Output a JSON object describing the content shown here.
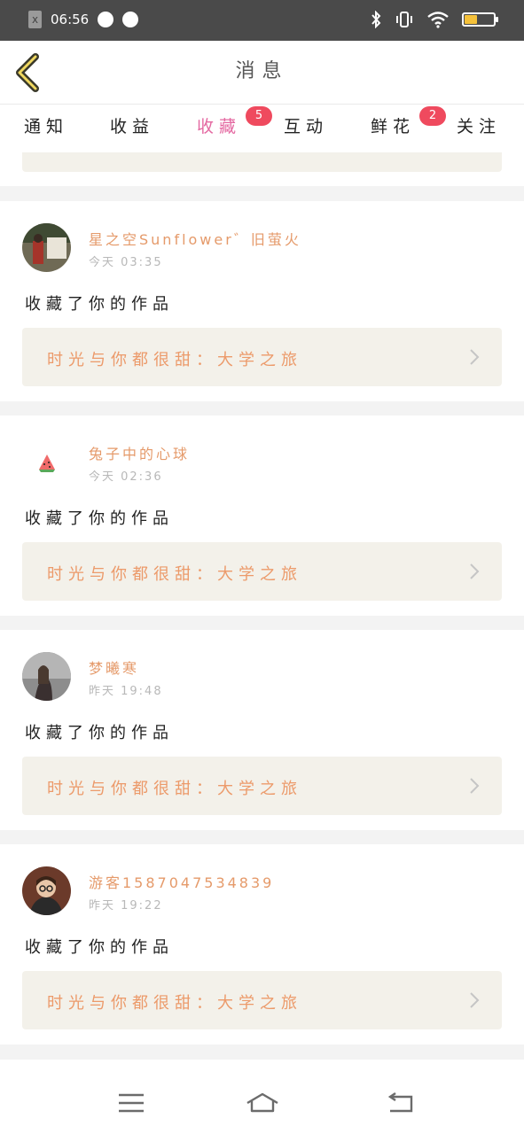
{
  "status_bar": {
    "time": "06:56",
    "notif_icon_label": "x"
  },
  "header": {
    "title": "消息",
    "back_icon": "chevron-left-icon"
  },
  "tabs": [
    {
      "label": "通知",
      "active": false
    },
    {
      "label": "收益",
      "active": false
    },
    {
      "label": "收藏",
      "active": true,
      "badge": "5"
    },
    {
      "label": "互动",
      "active": false
    },
    {
      "label": "鲜花",
      "active": false,
      "badge": "2"
    },
    {
      "label": "关注",
      "active": false
    }
  ],
  "notifications": [
    {
      "user": "星之空Sunflower゛旧萤火",
      "time": "今天 03:35",
      "action": "收藏了你的作品",
      "work": "时光与你都很甜：大学之旅",
      "avatar": "avatar-photo-1"
    },
    {
      "user": "兔子中的心球",
      "time": "今天 02:36",
      "action": "收藏了你的作品",
      "work": "时光与你都很甜：大学之旅",
      "avatar": "watermelon-avatar"
    },
    {
      "user": "梦曦寒",
      "time": "昨天 19:48",
      "action": "收藏了你的作品",
      "work": "时光与你都很甜：大学之旅",
      "avatar": "avatar-photo-2"
    },
    {
      "user": "游客1587047534839",
      "time": "昨天 19:22",
      "action": "收藏了你的作品",
      "work": "时光与你都很甜：大学之旅",
      "avatar": "avatar-photo-3"
    }
  ],
  "colors": {
    "accent": "#e468a1",
    "badge": "#ef4a5e",
    "username": "#e59a6a",
    "work_text": "#ec9a6a",
    "work_bg": "#f3f1ea",
    "status_bar": "#4a4a4a"
  },
  "nav": {
    "menu_icon": "menu-icon",
    "home_icon": "home-icon",
    "back_icon": "back-icon"
  }
}
